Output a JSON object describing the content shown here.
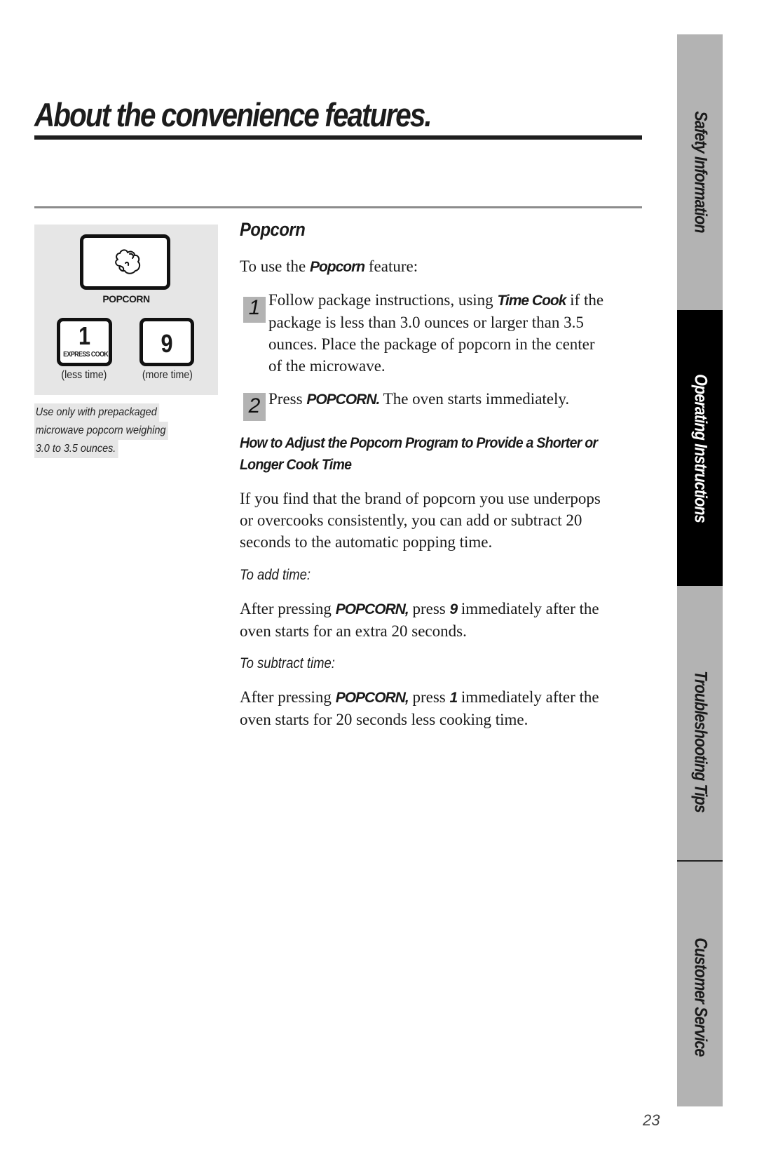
{
  "header": {
    "title": "About the convenience features."
  },
  "key_panel": {
    "popcorn_key_label": "POPCORN",
    "key_1": {
      "number": "1",
      "sublabel": "EXPRESS COOK",
      "caption": "(less time)"
    },
    "key_9": {
      "number": "9",
      "caption": "(more time)"
    },
    "note_lines": [
      "Use only with prepackaged",
      "microwave popcorn weighing",
      "3.0 to 3.5 ounces."
    ]
  },
  "section": {
    "heading": "Popcorn",
    "intro": {
      "before": "To use the ",
      "emphasis": "Popcorn",
      "after": " feature:"
    },
    "steps": [
      {
        "number": "1",
        "lines": [
          {
            "before": "Follow package instructions, using ",
            "emphasis": "Time Cook",
            "after": " if the"
          },
          {
            "text": "package is less than 3.0 ounces or larger than 3.5"
          },
          {
            "text": "ounces. Place the package of popcorn in the center"
          },
          {
            "text": "of the microwave."
          }
        ]
      },
      {
        "number": "2",
        "before": "Press ",
        "emphasis": "POPCORN.",
        "after": " The oven starts immediately."
      }
    ],
    "adjust_heading_lines": [
      "How to Adjust the Popcorn Program to Provide a Shorter or",
      "Longer Cook Time"
    ],
    "adjust_paragraph_lines": [
      "If you find that the brand of popcorn you use underpops",
      "or overcooks consistently, you can add or subtract 20",
      "seconds to the automatic popping time."
    ],
    "add_time": {
      "label": "To add time:",
      "line1": {
        "before": "After pressing ",
        "emphasis1": "POPCORN,",
        "middle": " press ",
        "emphasis2": "9",
        "after": " immediately after the"
      },
      "line2": "oven starts for an extra 20 seconds."
    },
    "subtract_time": {
      "label": "To subtract time:",
      "line1": {
        "before": "After pressing ",
        "emphasis1": "POPCORN,",
        "middle": " press ",
        "emphasis2": "1",
        "after": " immediately after the"
      },
      "line2": "oven starts for 20 seconds less cooking time."
    }
  },
  "side_tabs": [
    {
      "label": "Safety Information",
      "active": false
    },
    {
      "label": "Operating Instructions",
      "active": true
    },
    {
      "label": "Troubleshooting Tips",
      "active": false
    },
    {
      "label": "Customer Service",
      "active": false
    }
  ],
  "footer": {
    "page_number": "23"
  },
  "colors": {
    "active_tab": "#000000",
    "inactive_tab": "#b3b3b3",
    "panel_background": "#e6e6e6",
    "step_badge": "#b3b3b3"
  }
}
